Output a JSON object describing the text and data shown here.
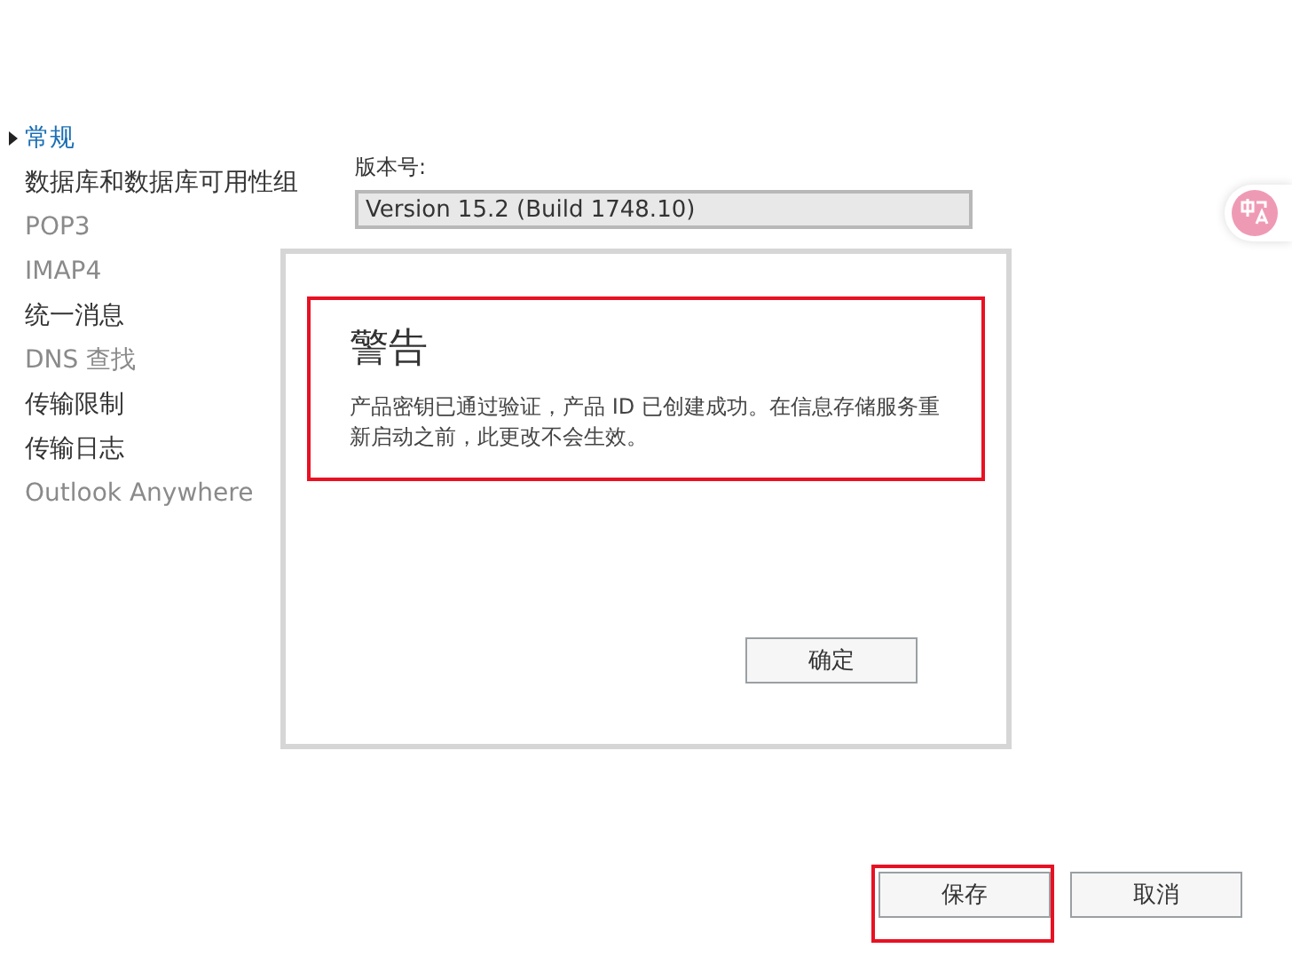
{
  "sidebar": {
    "items": [
      {
        "label": "常规",
        "selected": true,
        "disabled": false
      },
      {
        "label": "数据库和数据库可用性组",
        "selected": false,
        "disabled": false
      },
      {
        "label": "POP3",
        "selected": false,
        "disabled": true
      },
      {
        "label": "IMAP4",
        "selected": false,
        "disabled": true
      },
      {
        "label": "统一消息",
        "selected": false,
        "disabled": false
      },
      {
        "label": "DNS 查找",
        "selected": false,
        "disabled": true
      },
      {
        "label": "传输限制",
        "selected": false,
        "disabled": false
      },
      {
        "label": "传输日志",
        "selected": false,
        "disabled": false
      },
      {
        "label": "Outlook Anywhere",
        "selected": false,
        "disabled": true
      }
    ]
  },
  "version_field": {
    "label": "版本号:",
    "value": "Version 15.2 (Build 1748.10)"
  },
  "dialog": {
    "title": "警告",
    "message": "产品密钥已通过验证，产品 ID 已创建成功。在信息存储服务重新启动之前，此更改不会生效。",
    "button": "确定"
  },
  "footer": {
    "buttons": [
      {
        "label": "保存",
        "highlighted": true
      },
      {
        "label": "取消",
        "highlighted": false
      }
    ]
  }
}
